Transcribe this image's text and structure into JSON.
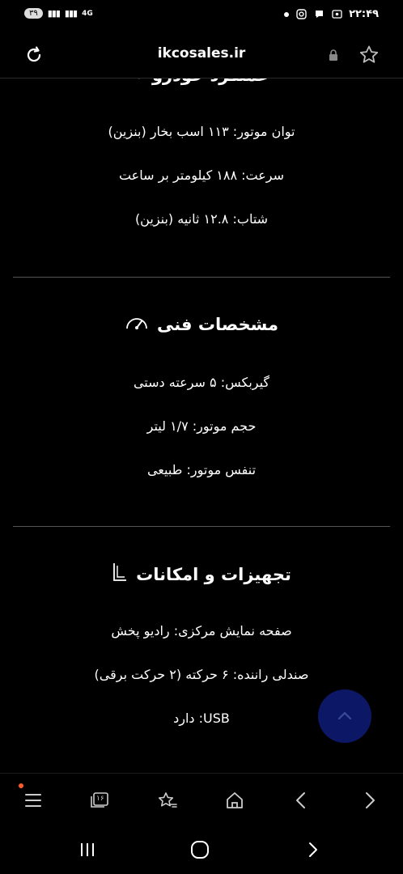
{
  "status_bar": {
    "battery": "۳۹",
    "network": "4G",
    "time": "۲۲:۴۹"
  },
  "browser": {
    "domain": "ikcosales.ir"
  },
  "content": {
    "partial_title": "عملکرد خودرو",
    "performance_lines": [
      "توان موتور: ۱۱۳ اسب بخار (بنزین)",
      "سرعت: ۱۸۸ کیلومتر بر ساعت",
      "شتاب: ۱۲.۸ ثانیه (بنزین)"
    ],
    "specs": {
      "title": "مشخصات فنی",
      "lines": [
        "گیربکس: ۵ سرعته دستی",
        "حجم موتور: ۱/۷ لیتر",
        "تنفس موتور: طبیعی"
      ]
    },
    "equipment": {
      "title": "تجهیزات و امکانات",
      "lines": [
        "صفحه نمایش مرکزی: رادیو پخش",
        "صندلی راننده: ۶ حرکته (۲ حرکت برقی)",
        "USB: دارد"
      ]
    }
  },
  "toolbar": {
    "tab_count": "۱۶"
  },
  "colors": {
    "background": "#000000",
    "fab": "#0c1766",
    "divider": "#555555",
    "notification_dot": "#ff5a2a"
  }
}
